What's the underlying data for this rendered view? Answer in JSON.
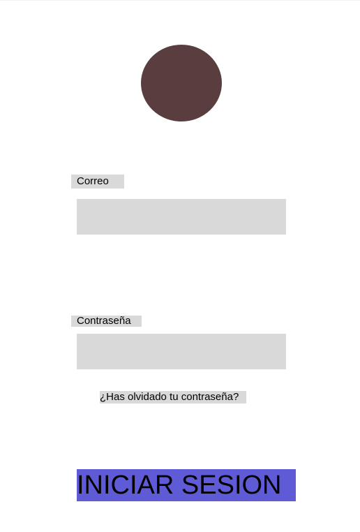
{
  "login": {
    "email_label": "Correo",
    "email_value": "",
    "password_label": "Contraseña",
    "password_value": "",
    "forgot_password": "¿Has olvidado tu contraseña?",
    "submit_label": "INICIAR SESION"
  },
  "colors": {
    "avatar": "#5a3d3f",
    "field_background": "#d9d9d9",
    "button_background": "#5f5bd6"
  }
}
